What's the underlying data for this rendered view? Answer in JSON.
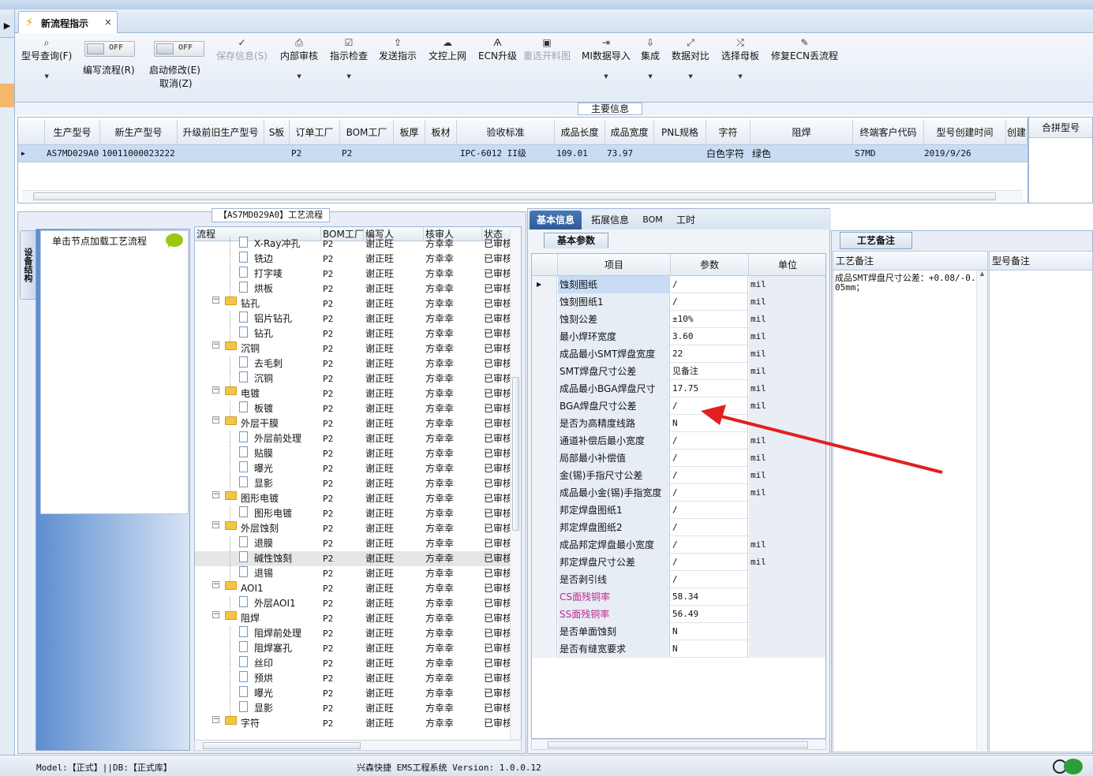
{
  "window": {
    "tab_title": "新流程指示",
    "tab_close": "×"
  },
  "toolbar": {
    "items": [
      {
        "label": "型号查询(F)",
        "icon": "⌕"
      },
      {
        "label": "保存信息(S)",
        "icon": "✓"
      },
      {
        "label": "内部审核",
        "icon": "⎙"
      },
      {
        "label": "指示检查",
        "icon": "☑"
      },
      {
        "label": "发送指示",
        "icon": "⇪"
      },
      {
        "label": "文控上网",
        "icon": "☁"
      },
      {
        "label": "ECN升级",
        "icon": "Ѧ"
      },
      {
        "label": "重选开料图",
        "icon": "▣"
      },
      {
        "label": "MI数据导入",
        "icon": "⇥"
      },
      {
        "label": "集成",
        "icon": "⇩"
      },
      {
        "label": "数据对比",
        "icon": "⤢"
      },
      {
        "label": "选择母板",
        "icon": "⤭"
      },
      {
        "label": "修复ECN丢流程",
        "icon": "✎"
      }
    ],
    "toggles": [
      {
        "state": "OFF",
        "label": "编写流程(R)"
      },
      {
        "state": "OFF",
        "label": "启动修改(E)",
        "label2": "取消(Z)"
      }
    ]
  },
  "main_info": {
    "label": "主要信息",
    "headers": [
      "生产型号",
      "新生产型号",
      "升级前旧生产型号",
      "S板",
      "订单工厂",
      "BOM工厂",
      "板厚",
      "板材",
      "验收标准",
      "成品长度",
      "成品宽度",
      "PNL规格",
      "字符",
      "阻焊",
      "终端客户代码",
      "型号创建时间",
      "创建"
    ],
    "row": [
      "AS7MD029A0",
      "10011000023222",
      "",
      "",
      "P2",
      "P2",
      "",
      "",
      "IPC-6012 II级",
      "109.01",
      "73.97",
      "",
      "白色字符",
      "绿色",
      "S7MD",
      "2019/9/26",
      ""
    ],
    "merge_header": "合拼型号"
  },
  "process_panel": {
    "title": "【AS7MD029A0】工艺流程",
    "side_tab": "设备结构",
    "node_hint": "单击节点加载工艺流程",
    "headers": [
      "流程",
      "BOM工厂",
      "编写人",
      "核审人",
      "状态"
    ],
    "rows": [
      {
        "level": 2,
        "name": "X-Ray冲孔",
        "bom": "P2",
        "writer": "谢正旺",
        "reviewer": "方幸幸",
        "status": "已审核"
      },
      {
        "level": 2,
        "name": "铣边",
        "bom": "P2",
        "writer": "谢正旺",
        "reviewer": "方幸幸",
        "status": "已审核"
      },
      {
        "level": 2,
        "name": "打字唛",
        "bom": "P2",
        "writer": "谢正旺",
        "reviewer": "方幸幸",
        "status": "已审核"
      },
      {
        "level": 2,
        "name": "烘板",
        "bom": "P2",
        "writer": "谢正旺",
        "reviewer": "方幸幸",
        "status": "已审核"
      },
      {
        "level": 1,
        "name": "钻孔",
        "bom": "P2",
        "writer": "谢正旺",
        "reviewer": "方幸幸",
        "status": "已审核"
      },
      {
        "level": 2,
        "name": "铝片钻孔",
        "bom": "P2",
        "writer": "谢正旺",
        "reviewer": "方幸幸",
        "status": "已审核"
      },
      {
        "level": 2,
        "name": "钻孔",
        "bom": "P2",
        "writer": "谢正旺",
        "reviewer": "方幸幸",
        "status": "已审核"
      },
      {
        "level": 1,
        "name": "沉铜",
        "bom": "P2",
        "writer": "谢正旺",
        "reviewer": "方幸幸",
        "status": "已审核"
      },
      {
        "level": 2,
        "name": "去毛刺",
        "bom": "P2",
        "writer": "谢正旺",
        "reviewer": "方幸幸",
        "status": "已审核"
      },
      {
        "level": 2,
        "name": "沉铜",
        "bom": "P2",
        "writer": "谢正旺",
        "reviewer": "方幸幸",
        "status": "已审核"
      },
      {
        "level": 1,
        "name": "电镀",
        "bom": "P2",
        "writer": "谢正旺",
        "reviewer": "方幸幸",
        "status": "已审核"
      },
      {
        "level": 2,
        "name": "板镀",
        "bom": "P2",
        "writer": "谢正旺",
        "reviewer": "方幸幸",
        "status": "已审核"
      },
      {
        "level": 1,
        "name": "外层干膜",
        "bom": "P2",
        "writer": "谢正旺",
        "reviewer": "方幸幸",
        "status": "已审核"
      },
      {
        "level": 2,
        "name": "外层前处理",
        "bom": "P2",
        "writer": "谢正旺",
        "reviewer": "方幸幸",
        "status": "已审核"
      },
      {
        "level": 2,
        "name": "贴膜",
        "bom": "P2",
        "writer": "谢正旺",
        "reviewer": "方幸幸",
        "status": "已审核"
      },
      {
        "level": 2,
        "name": "曝光",
        "bom": "P2",
        "writer": "谢正旺",
        "reviewer": "方幸幸",
        "status": "已审核"
      },
      {
        "level": 2,
        "name": "显影",
        "bom": "P2",
        "writer": "谢正旺",
        "reviewer": "方幸幸",
        "status": "已审核"
      },
      {
        "level": 1,
        "name": "图形电镀",
        "bom": "P2",
        "writer": "谢正旺",
        "reviewer": "方幸幸",
        "status": "已审核"
      },
      {
        "level": 2,
        "name": "图形电镀",
        "bom": "P2",
        "writer": "谢正旺",
        "reviewer": "方幸幸",
        "status": "已审核"
      },
      {
        "level": 1,
        "name": "外层蚀刻",
        "bom": "P2",
        "writer": "谢正旺",
        "reviewer": "方幸幸",
        "status": "已审核"
      },
      {
        "level": 2,
        "name": "退膜",
        "bom": "P2",
        "writer": "谢正旺",
        "reviewer": "方幸幸",
        "status": "已审核"
      },
      {
        "level": 2,
        "name": "碱性蚀刻",
        "bom": "P2",
        "writer": "谢正旺",
        "reviewer": "方幸幸",
        "status": "已审核",
        "selected": true
      },
      {
        "level": 2,
        "name": "退锡",
        "bom": "P2",
        "writer": "谢正旺",
        "reviewer": "方幸幸",
        "status": "已审核"
      },
      {
        "level": 1,
        "name": "AOI1",
        "bom": "P2",
        "writer": "谢正旺",
        "reviewer": "方幸幸",
        "status": "已审核"
      },
      {
        "level": 2,
        "name": "外层AOI1",
        "bom": "P2",
        "writer": "谢正旺",
        "reviewer": "方幸幸",
        "status": "已审核"
      },
      {
        "level": 1,
        "name": "阻焊",
        "bom": "P2",
        "writer": "谢正旺",
        "reviewer": "方幸幸",
        "status": "已审核"
      },
      {
        "level": 2,
        "name": "阻焊前处理",
        "bom": "P2",
        "writer": "谢正旺",
        "reviewer": "方幸幸",
        "status": "已审核"
      },
      {
        "level": 2,
        "name": "阻焊塞孔",
        "bom": "P2",
        "writer": "谢正旺",
        "reviewer": "方幸幸",
        "status": "已审核"
      },
      {
        "level": 2,
        "name": "丝印",
        "bom": "P2",
        "writer": "谢正旺",
        "reviewer": "方幸幸",
        "status": "已审核"
      },
      {
        "level": 2,
        "name": "预烘",
        "bom": "P2",
        "writer": "谢正旺",
        "reviewer": "方幸幸",
        "status": "已审核"
      },
      {
        "level": 2,
        "name": "曝光",
        "bom": "P2",
        "writer": "谢正旺",
        "reviewer": "方幸幸",
        "status": "已审核"
      },
      {
        "level": 2,
        "name": "显影",
        "bom": "P2",
        "writer": "谢正旺",
        "reviewer": "方幸幸",
        "status": "已审核"
      },
      {
        "level": 1,
        "name": "字符",
        "bom": "P2",
        "writer": "谢正旺",
        "reviewer": "方幸幸",
        "status": "已审核"
      }
    ]
  },
  "detail_panel": {
    "tabs": [
      "基本信息",
      "拓展信息",
      "BOM",
      "工时"
    ],
    "subtab": "基本参数",
    "headers": [
      "项目",
      "参数",
      "单位"
    ],
    "rows": [
      {
        "item": "蚀刻图纸",
        "value": "/",
        "unit": "mil",
        "selected": true
      },
      {
        "item": "蚀刻图纸1",
        "value": "/",
        "unit": "mil"
      },
      {
        "item": "蚀刻公差",
        "value": "±10%",
        "unit": "mil"
      },
      {
        "item": "最小焊环宽度",
        "value": "3.60",
        "unit": "mil"
      },
      {
        "item": "成品最小SMT焊盘宽度",
        "value": "22",
        "unit": "mil"
      },
      {
        "item": "SMT焊盘尺寸公差",
        "value": "见备注",
        "unit": "mil"
      },
      {
        "item": "成品最小BGA焊盘尺寸",
        "value": "17.75",
        "unit": "mil"
      },
      {
        "item": "BGA焊盘尺寸公差",
        "value": "/",
        "unit": "mil"
      },
      {
        "item": "是否为高精度线路",
        "value": "N",
        "unit": ""
      },
      {
        "item": "通道补偿后最小宽度",
        "value": "/",
        "unit": "mil"
      },
      {
        "item": "局部最小补偿值",
        "value": "/",
        "unit": "mil"
      },
      {
        "item": "金(锡)手指尺寸公差",
        "value": "/",
        "unit": "mil"
      },
      {
        "item": "成品最小金(锡)手指宽度",
        "value": "/",
        "unit": "mil"
      },
      {
        "item": "邦定焊盘图纸1",
        "value": "/",
        "unit": ""
      },
      {
        "item": "邦定焊盘图纸2",
        "value": "/",
        "unit": ""
      },
      {
        "item": "成品邦定焊盘最小宽度",
        "value": "/",
        "unit": "mil"
      },
      {
        "item": "邦定焊盘尺寸公差",
        "value": "/",
        "unit": "mil"
      },
      {
        "item": "是否剥引线",
        "value": "/",
        "unit": ""
      },
      {
        "item": "CS面残铜率",
        "value": "58.34",
        "unit": "",
        "pink": true
      },
      {
        "item": "SS面残铜率",
        "value": "56.49",
        "unit": "",
        "pink": true
      },
      {
        "item": "是否单面蚀刻",
        "value": "N",
        "unit": ""
      },
      {
        "item": "是否有缝宽要求",
        "value": "N",
        "unit": ""
      }
    ]
  },
  "notes_panel": {
    "tab": "工艺备注",
    "col1": "工艺备注",
    "col2": "型号备注",
    "text": "成品SMT焊盘尺寸公差：+0.08/-0.05mm；"
  },
  "status": {
    "left": "Model:【正式】||DB:【正式库】",
    "center": "兴森快捷 EMS工程系统 Version: 1.0.0.12"
  },
  "colors": {
    "accent": "#2d5a98",
    "annotation_arrow": "#e02020",
    "selection": "#c8dcf4"
  }
}
